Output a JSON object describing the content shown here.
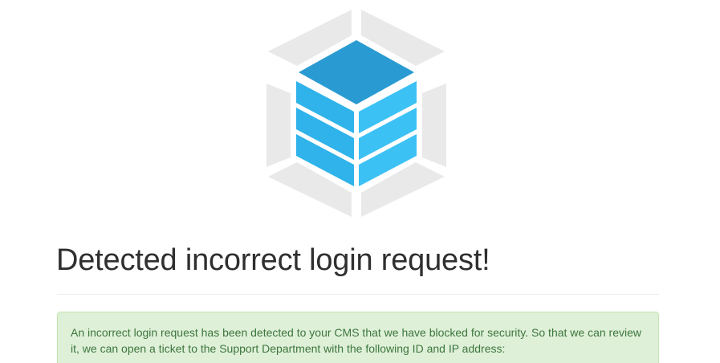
{
  "logo": {
    "icon": "layered-cube-logo-icon",
    "colors": {
      "frame": "#e9e9e9",
      "top_face": "#2a9bd2",
      "side_face": "#2fb3ea",
      "right_face": "#3cc1f4"
    }
  },
  "main": {
    "title": "Detected incorrect login request!",
    "alert": {
      "text": "An incorrect login request has been detected to your CMS that we have blocked for security. So that we can review it, we can open a ticket to the Support Department with the following ID and IP address:",
      "colors": {
        "background": "#dff0d8",
        "border": "#c3e6b0",
        "text": "#3c763d"
      }
    }
  }
}
